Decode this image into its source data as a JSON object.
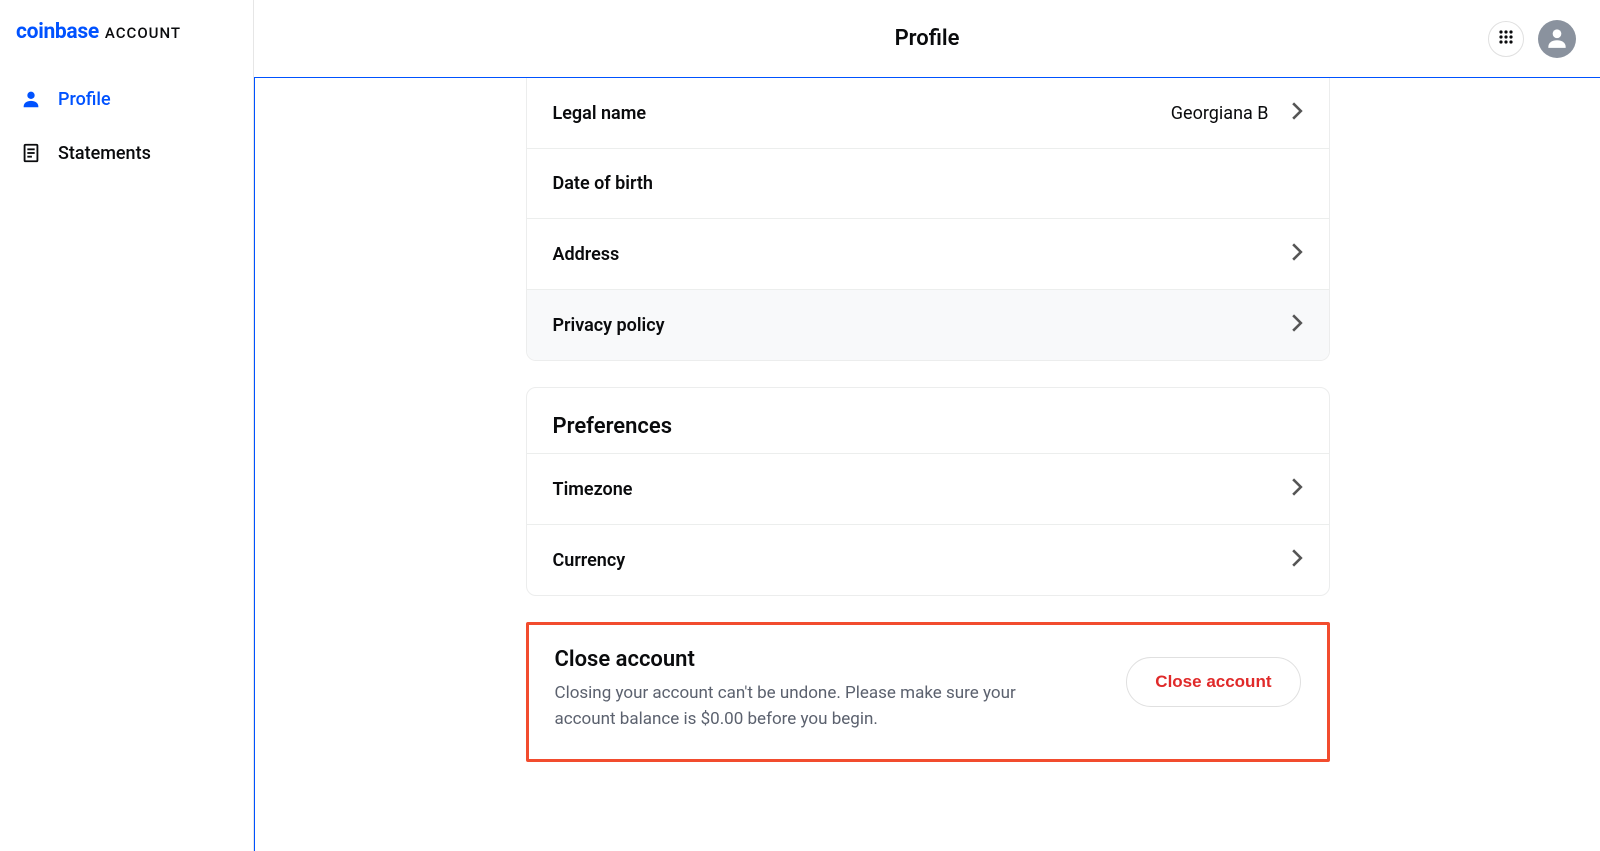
{
  "brand": {
    "name": "coinbase",
    "suffix": "ACCOUNT"
  },
  "nav": {
    "profile": "Profile",
    "statements": "Statements"
  },
  "header": {
    "title": "Profile"
  },
  "personal": {
    "rows": {
      "legal_name": {
        "label": "Legal name",
        "value": "Georgiana B"
      },
      "dob": {
        "label": "Date of birth",
        "value": ""
      },
      "address": {
        "label": "Address",
        "value": ""
      },
      "privacy": {
        "label": "Privacy policy",
        "value": ""
      }
    }
  },
  "preferences": {
    "title": "Preferences",
    "rows": {
      "timezone": {
        "label": "Timezone",
        "value": ""
      },
      "currency": {
        "label": "Currency",
        "value": ""
      }
    }
  },
  "close": {
    "title": "Close account",
    "description": "Closing your account can't be undone. Please make sure your account balance is $0.00 before you begin.",
    "button": "Close account"
  },
  "colors": {
    "primary": "#0052ff",
    "highlight_border": "#f24c2e",
    "danger_text": "#e02a2a"
  }
}
